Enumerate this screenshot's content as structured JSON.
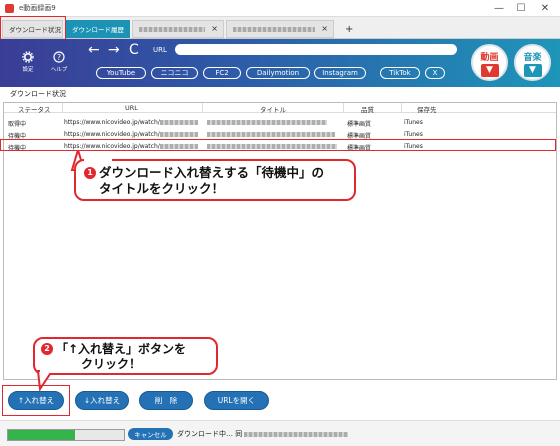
{
  "window": {
    "title": "e動画録画9",
    "minimize": "—",
    "maximize": "☐",
    "close": "✕"
  },
  "tabs": [
    {
      "label": "ダウンロード状況"
    },
    {
      "label": "ダウンロード履歴"
    },
    {
      "label": "",
      "close": "×"
    },
    {
      "label": "",
      "close": "×"
    },
    {
      "label": "+"
    }
  ],
  "toolbar": {
    "settings_label": "設定",
    "help_label": "ヘルプ",
    "back": "←",
    "forward": "→",
    "reload": "C",
    "url_label": "URL",
    "url_value": "",
    "sites": [
      "YouTube",
      "ニコニコ",
      "FC2",
      "Dailymotion",
      "Instagram",
      "TikTok",
      "X"
    ],
    "video_button": "動画",
    "music_button": "音楽"
  },
  "download_status": {
    "section_title": "ダウンロード状況",
    "columns": [
      "ステータス",
      "URL",
      "タイトル",
      "品質",
      "保存先"
    ],
    "rows": [
      {
        "status": "取得中",
        "url": "https://www.nicovideo.jp/watch/",
        "quality": "標準画質",
        "destination": "iTunes"
      },
      {
        "status": "待機中",
        "url": "https://www.nicovideo.jp/watch/",
        "quality": "標準画質",
        "destination": "iTunes"
      },
      {
        "status": "待機中",
        "url": "https://www.nicovideo.jp/watch/",
        "quality": "標準画質",
        "destination": "iTunes"
      }
    ]
  },
  "callouts": [
    {
      "number": "1",
      "line1": "ダウンロード入れ替えする「待機中」の",
      "line2": "タイトルをクリック！"
    },
    {
      "number": "2",
      "line1": "「↑入れ替え」ボタンを",
      "line2": "クリック！"
    }
  ],
  "buttons": {
    "move_up": "↑入れ替え",
    "move_down": "↓入れ替え",
    "delete": "削　除",
    "open_url": "URLを開く"
  },
  "status_bar": {
    "progress": 0.58,
    "cancel": "キャンセル",
    "text": "ダウンロード中… 同"
  },
  "colors": {
    "accent": "#2472b5",
    "highlight": "#e0282e",
    "progress": "#36b34a",
    "video_icon": "#e0392f",
    "music_icon": "#1e96b8"
  }
}
